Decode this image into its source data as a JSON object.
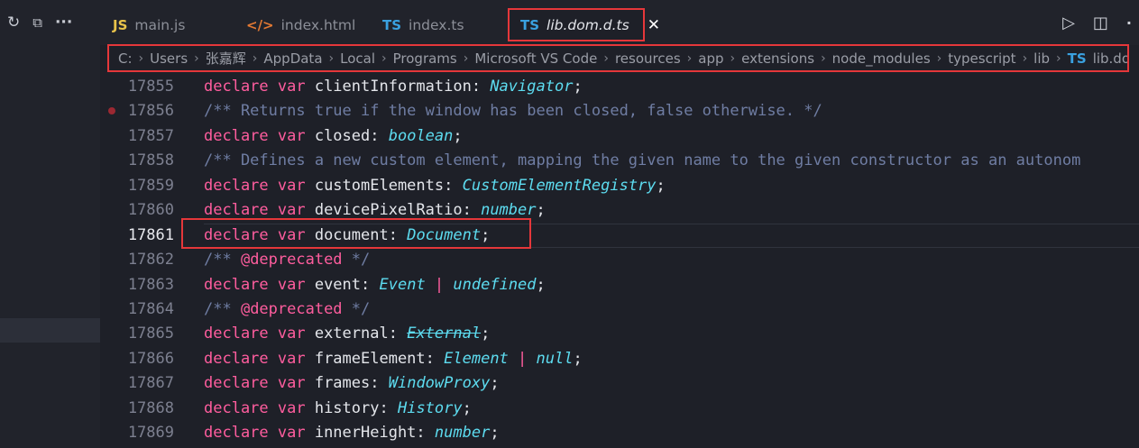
{
  "toolbar": {
    "refresh_icon": "↻",
    "collapse_icon": "⧉",
    "more_icon": "···"
  },
  "tabs": [
    {
      "icon": "JS",
      "icon_color": "#e8c34a",
      "label": "main.js"
    },
    {
      "icon": "</>",
      "icon_color": "#e37933",
      "label": "index.html"
    },
    {
      "icon": "TS",
      "icon_color": "#3aa1e0",
      "label": "index.ts"
    },
    {
      "icon": "TS",
      "icon_color": "#3aa1e0",
      "label": "lib.dom.d.ts",
      "close": "✕"
    }
  ],
  "tab_actions": {
    "run": "▷",
    "split": "◫",
    "more": "·"
  },
  "breadcrumb": {
    "separator": "›",
    "items": [
      "C:",
      "Users",
      "张嘉辉",
      "AppData",
      "Local",
      "Programs",
      "Microsoft VS Code",
      "resources",
      "app",
      "extensions",
      "node_modules",
      "typescript",
      "lib"
    ],
    "file_icon": "TS",
    "file": "lib.dom.d.ts"
  },
  "code": {
    "line_numbers": [
      "17855",
      "17856",
      "17857",
      "17858",
      "17859",
      "17860",
      "17861",
      "17862",
      "17863",
      "17864",
      "17865",
      "17866",
      "17867",
      "17868",
      "17869"
    ],
    "lines": [
      {
        "kw": "declare var ",
        "id": "clientInformation",
        "p1": ": ",
        "ty": "Navigator",
        "end": ";"
      },
      {
        "comment": "/** Returns true if the window has been closed, false otherwise. */"
      },
      {
        "kw": "declare var ",
        "id": "closed",
        "p1": ": ",
        "ty": "boolean",
        "end": ";"
      },
      {
        "comment": "/** Defines a new custom element, mapping the given name to the given constructor as an autonom"
      },
      {
        "kw": "declare var ",
        "id": "customElements",
        "p1": ": ",
        "ty": "CustomElementRegistry",
        "end": ";"
      },
      {
        "kw": "declare var ",
        "id": "devicePixelRatio",
        "p1": ": ",
        "ty": "number",
        "end": ";"
      },
      {
        "kw": "declare var ",
        "id": "document",
        "p1": ": ",
        "ty": "Document",
        "end": ";"
      },
      {
        "c1": "/** ",
        "tag": "@deprecated",
        "c2": " */"
      },
      {
        "kw": "declare var ",
        "id": "event",
        "p1": ": ",
        "ty": "Event",
        "bar": " | ",
        "ty2": "undefined",
        "end": ";"
      },
      {
        "c1": "/** ",
        "tag": "@deprecated",
        "c2": " */"
      },
      {
        "kw": "declare var ",
        "id": "external",
        "p1": ": ",
        "ty": "External",
        "end": ";"
      },
      {
        "kw": "declare var ",
        "id": "frameElement",
        "p1": ": ",
        "ty": "Element",
        "bar": " | ",
        "ty2": "null",
        "end": ";"
      },
      {
        "kw": "declare var ",
        "id": "frames",
        "p1": ": ",
        "ty": "WindowProxy",
        "end": ";"
      },
      {
        "kw": "declare var ",
        "id": "history",
        "p1": ": ",
        "ty": "History",
        "end": ";"
      },
      {
        "kw": "declare var ",
        "id": "innerHeight",
        "p1": ": ",
        "ty": "number",
        "end": ";"
      }
    ]
  }
}
